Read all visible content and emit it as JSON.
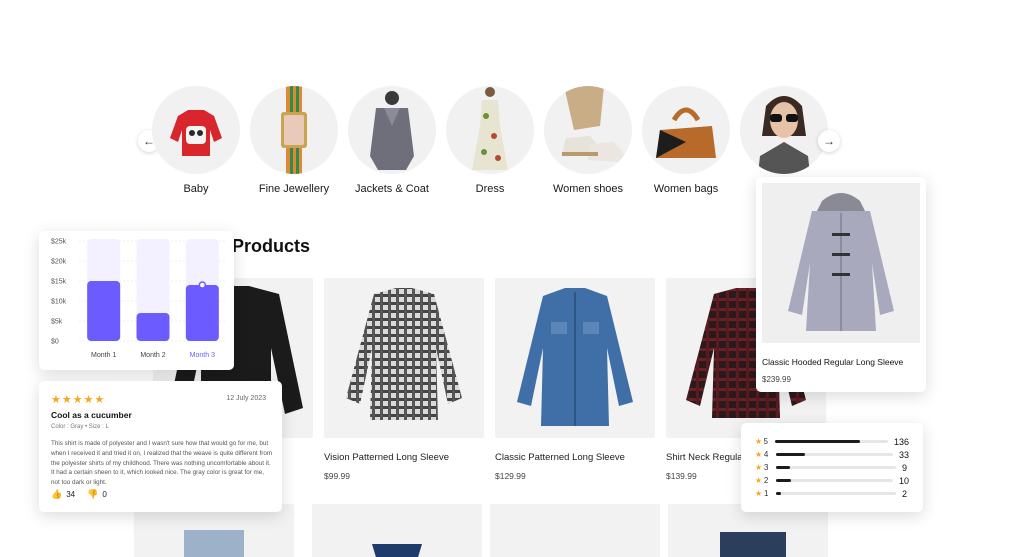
{
  "categories": [
    {
      "label": "Baby",
      "icon": "sweater-image"
    },
    {
      "label": "Fine Jewellery",
      "icon": "watch-image"
    },
    {
      "label": "Jackets & Coat",
      "icon": "coat-model-image"
    },
    {
      "label": "Dress",
      "icon": "dress-model-image"
    },
    {
      "label": "Women shoes",
      "icon": "sneakers-image"
    },
    {
      "label": "Women bags",
      "icon": "handbag-image"
    },
    {
      "label": "",
      "icon": "sunglasses-model-image"
    }
  ],
  "carousel": {
    "prev_icon": "←",
    "next_icon": "→"
  },
  "section": {
    "title": "Products"
  },
  "products": [
    {
      "name": "",
      "price": ""
    },
    {
      "name": "Vision Patterned Long Sleeve",
      "price": "$99.99"
    },
    {
      "name": "Classic Patterned Long Sleeve",
      "price": "$129.99"
    },
    {
      "name": "Shirt Neck Regular",
      "price": "$139.99"
    }
  ],
  "chart_data": {
    "type": "bar",
    "categories": [
      "Month 1",
      "Month 2",
      "Month 3"
    ],
    "values": [
      15000,
      7000,
      14000
    ],
    "yticks": [
      "$25k",
      "$20k",
      "$15k",
      "$10k",
      "$5k",
      "$0"
    ],
    "ylim": [
      0,
      25000
    ],
    "highlight_index": 2,
    "colors": {
      "bar": "#6c5cff",
      "track": "#f3f1ff",
      "highlight_label": "#6c5cff"
    }
  },
  "review": {
    "stars": "★★★★★",
    "date": "12 July 2023",
    "title": "Cool as a cucumber",
    "meta": "Color : Gray  •  Size : L",
    "body": "This shirt is made of polyester and I wasn't sure how that would go for me, but when I received it and tried it on, I realized that the weave is quite different from the polyester shirts of my childhood. There was nothing uncomfortable about it. It had a certain sheen to it, which looked nice. The gray color is great for me, not too dark or light.",
    "likes": "34",
    "dislikes": "0"
  },
  "featured": {
    "name": "Classic Hooded Regular Long Sleeve",
    "price": "$239.99"
  },
  "ratings": [
    {
      "star": "5",
      "count": "136",
      "fraction": 0.75
    },
    {
      "star": "4",
      "count": "33",
      "fraction": 0.25
    },
    {
      "star": "3",
      "count": "9",
      "fraction": 0.12
    },
    {
      "star": "2",
      "count": "10",
      "fraction": 0.13
    },
    {
      "star": "1",
      "count": "2",
      "fraction": 0.04
    }
  ],
  "colors": {
    "accent": "#6c5cff",
    "star": "#f5a623"
  }
}
